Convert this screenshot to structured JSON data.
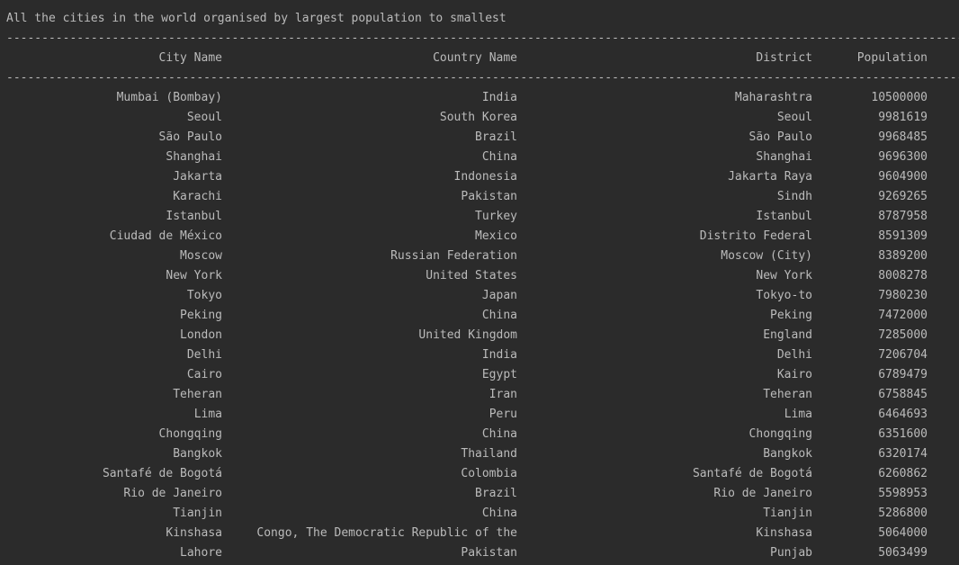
{
  "console": {
    "title": "All the cities in the world organised by largest population to smallest",
    "separator": "------------------------------------------------------------------------------------------------------------------------------------------------------------------------------"
  },
  "table": {
    "headers": {
      "city": "City Name",
      "country": "Country Name",
      "district": "District",
      "population": "Population"
    },
    "rows": [
      {
        "city": "Mumbai (Bombay)",
        "country": "India",
        "district": "Maharashtra",
        "population": "10500000"
      },
      {
        "city": "Seoul",
        "country": "South Korea",
        "district": "Seoul",
        "population": "9981619"
      },
      {
        "city": "São Paulo",
        "country": "Brazil",
        "district": "São Paulo",
        "population": "9968485"
      },
      {
        "city": "Shanghai",
        "country": "China",
        "district": "Shanghai",
        "population": "9696300"
      },
      {
        "city": "Jakarta",
        "country": "Indonesia",
        "district": "Jakarta Raya",
        "population": "9604900"
      },
      {
        "city": "Karachi",
        "country": "Pakistan",
        "district": "Sindh",
        "population": "9269265"
      },
      {
        "city": "Istanbul",
        "country": "Turkey",
        "district": "Istanbul",
        "population": "8787958"
      },
      {
        "city": "Ciudad de México",
        "country": "Mexico",
        "district": "Distrito Federal",
        "population": "8591309"
      },
      {
        "city": "Moscow",
        "country": "Russian Federation",
        "district": "Moscow (City)",
        "population": "8389200"
      },
      {
        "city": "New York",
        "country": "United States",
        "district": "New York",
        "population": "8008278"
      },
      {
        "city": "Tokyo",
        "country": "Japan",
        "district": "Tokyo-to",
        "population": "7980230"
      },
      {
        "city": "Peking",
        "country": "China",
        "district": "Peking",
        "population": "7472000"
      },
      {
        "city": "London",
        "country": "United Kingdom",
        "district": "England",
        "population": "7285000"
      },
      {
        "city": "Delhi",
        "country": "India",
        "district": "Delhi",
        "population": "7206704"
      },
      {
        "city": "Cairo",
        "country": "Egypt",
        "district": "Kairo",
        "population": "6789479"
      },
      {
        "city": "Teheran",
        "country": "Iran",
        "district": "Teheran",
        "population": "6758845"
      },
      {
        "city": "Lima",
        "country": "Peru",
        "district": "Lima",
        "population": "6464693"
      },
      {
        "city": "Chongqing",
        "country": "China",
        "district": "Chongqing",
        "population": "6351600"
      },
      {
        "city": "Bangkok",
        "country": "Thailand",
        "district": "Bangkok",
        "population": "6320174"
      },
      {
        "city": "Santafé de Bogotá",
        "country": "Colombia",
        "district": "Santafé de Bogotá",
        "population": "6260862"
      },
      {
        "city": "Rio de Janeiro",
        "country": "Brazil",
        "district": "Rio de Janeiro",
        "population": "5598953"
      },
      {
        "city": "Tianjin",
        "country": "China",
        "district": "Tianjin",
        "population": "5286800"
      },
      {
        "city": "Kinshasa",
        "country": "Congo, The Democratic Republic of the",
        "district": "Kinshasa",
        "population": "5064000"
      },
      {
        "city": "Lahore",
        "country": "Pakistan",
        "district": "Punjab",
        "population": "5063499"
      }
    ]
  }
}
